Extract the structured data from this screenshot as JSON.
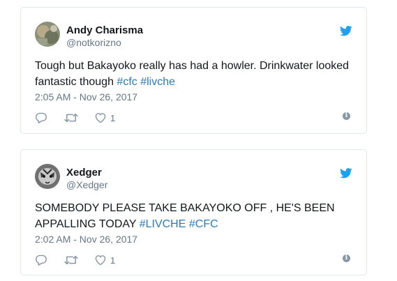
{
  "tweets": [
    {
      "name": "Andy Charisma",
      "handle": "@notkorizno",
      "text_plain": "Tough but Bakayoko really has had a howler. Drinkwater looked fantastic though ",
      "hashtags": [
        "#cfc",
        "#livche"
      ],
      "timestamp": "2:05 AM - Nov 26, 2017",
      "like_count": "1",
      "avatar_icon": "avatar-photo-icon"
    },
    {
      "name": "Xedger",
      "handle": "@Xedger",
      "text_plain": "SOMEBODY PLEASE TAKE BAKAYOKO OFF , HE'S BEEN APPALLING TODAY ",
      "hashtags": [
        "#LIVCHE",
        "#CFC"
      ],
      "timestamp": "2:02 AM - Nov 26, 2017",
      "like_count": "1",
      "avatar_icon": "avatar-photo-icon"
    }
  ],
  "info_glyph": "i",
  "colors": {
    "twitter_blue": "#1da1f2",
    "link_blue": "#2b7bb9",
    "muted_gray": "#657786",
    "icon_gray": "#8899a6",
    "border": "#e1e8ed"
  },
  "icons": [
    "twitter-bird-icon",
    "reply-icon",
    "retweet-icon",
    "heart-icon",
    "info-icon"
  ]
}
